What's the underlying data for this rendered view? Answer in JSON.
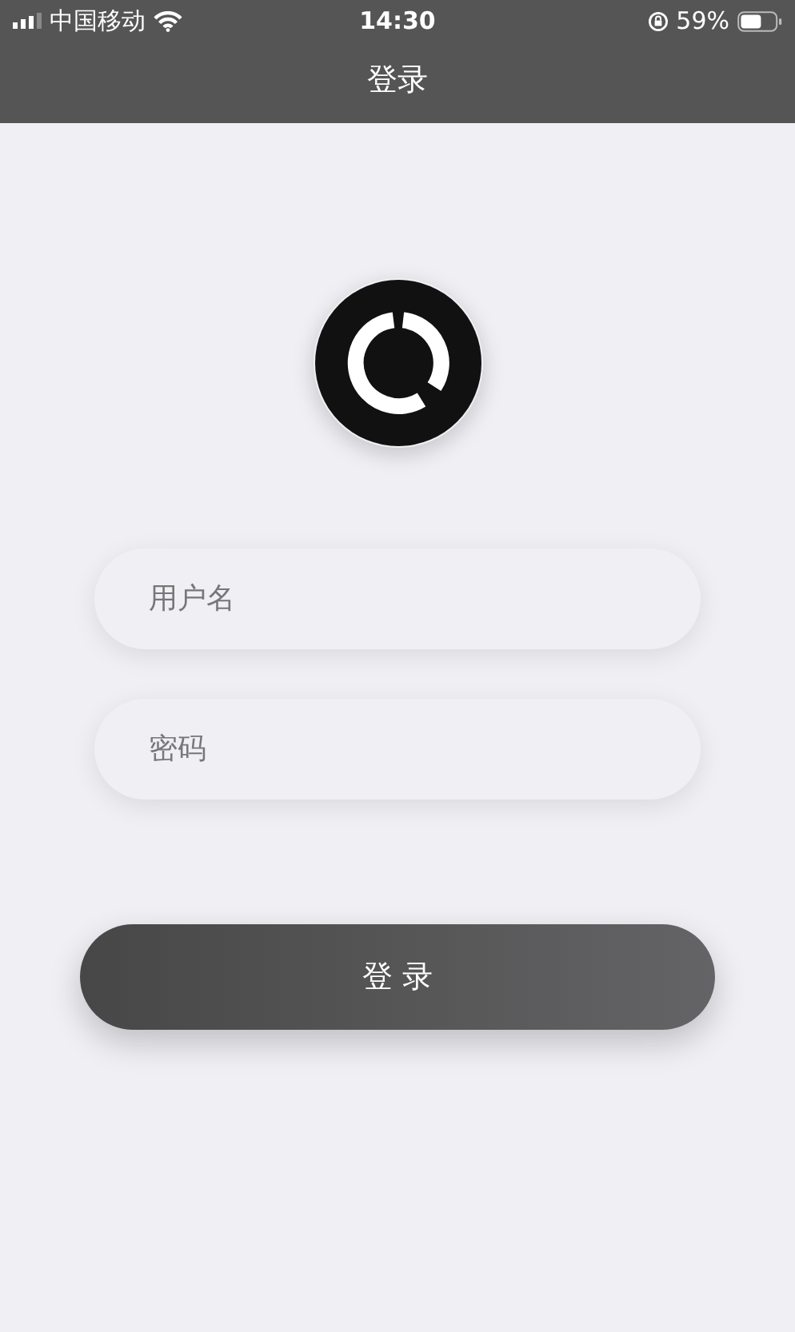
{
  "status_bar": {
    "carrier": "中国移动",
    "time": "14:30",
    "battery": "59%"
  },
  "nav_bar": {
    "title": "登录"
  },
  "form": {
    "fields": [
      {
        "placeholder": "用户名"
      },
      {
        "placeholder": "密码"
      }
    ],
    "submit": "登 录"
  }
}
